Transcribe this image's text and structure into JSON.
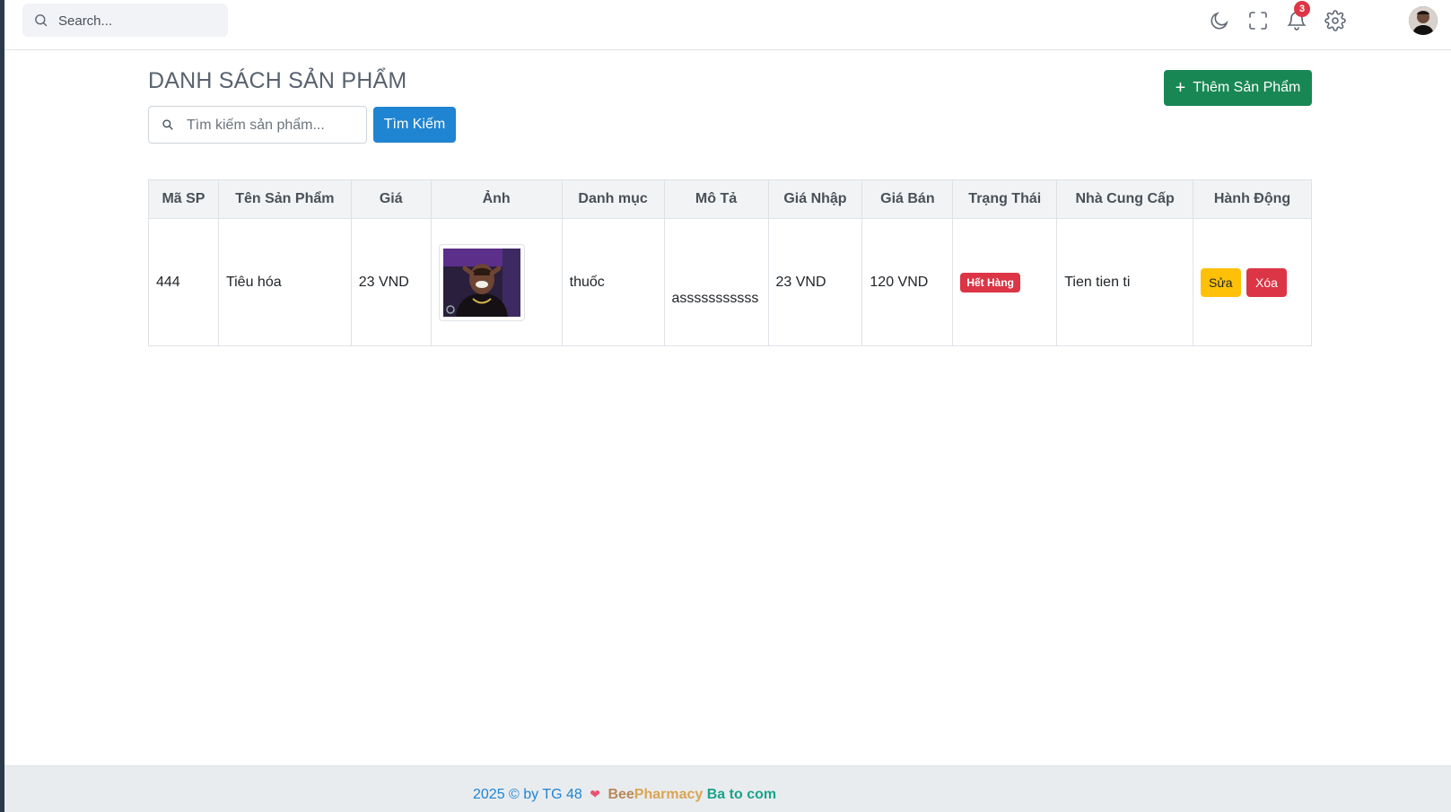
{
  "topbar": {
    "search_placeholder": "Search...",
    "notification_count": "3",
    "icons": [
      "moon-icon",
      "fullscreen-icon",
      "bell-icon",
      "gear-icon",
      "avatar"
    ]
  },
  "main": {
    "title": "DANH SÁCH SẢN PHẨM",
    "add_button": "Thêm Sản Phẩm",
    "search_placeholder": "Tìm kiếm sản phẩm...",
    "search_button": "Tìm Kiếm"
  },
  "table": {
    "headers": [
      "Mã SP",
      "Tên Sản Phẩm",
      "Giá",
      "Ảnh",
      "Danh mục",
      "Mô Tả",
      "Giá Nhập",
      "Giá Bán",
      "Trạng Thái",
      "Nhà Cung Cấp",
      "Hành Động"
    ],
    "rows": [
      {
        "id": "444",
        "name": "Tiêu hóa",
        "price": "23 VND",
        "category": "thuốc",
        "description": "asssssssssss",
        "import_price": "23 VND",
        "sale_price": "120 VND",
        "status": "Hết Hàng",
        "supplier": "Tien tien ti",
        "edit_label": "Sửa",
        "delete_label": "Xóa"
      }
    ]
  },
  "footer": {
    "copyright": "2025 © by TG 48",
    "heart": "❤",
    "bee": "Bee",
    "pharmacy": "Pharmacy",
    "suffix": "Ba to com"
  },
  "colors": {
    "primary": "#1f84d1",
    "success": "#198754",
    "warning": "#ffc107",
    "danger": "#dc3545",
    "sidebar_edge": "#2b3a4a"
  }
}
